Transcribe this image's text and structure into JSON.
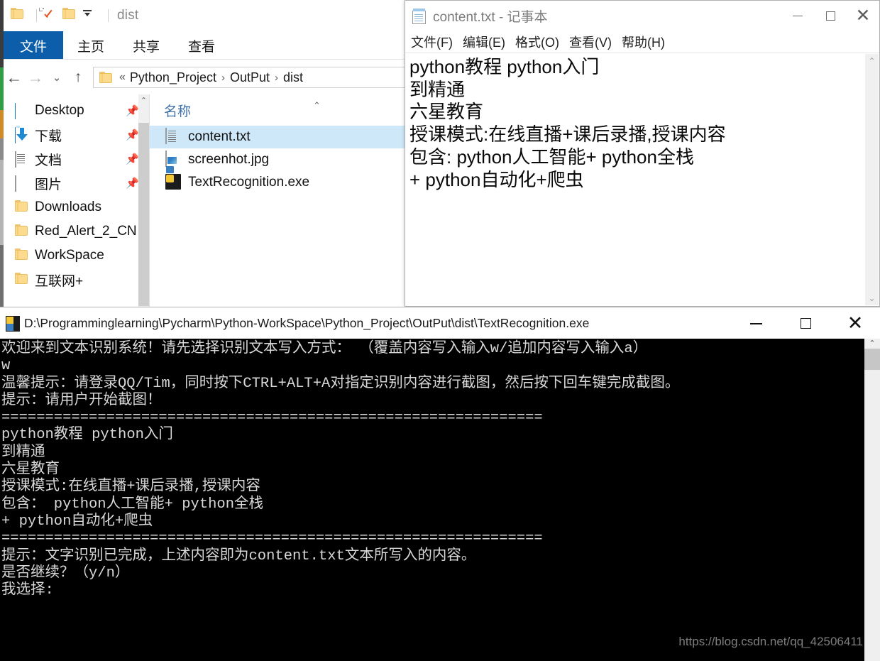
{
  "background_sliver": {
    "colors": [
      "#3c3c3c",
      "#2f9e44",
      "#d08a28",
      "#8a8a8a",
      "#b5b5b5",
      "#6f6f6f"
    ]
  },
  "explorer": {
    "quick_access": {
      "title": "dist",
      "icons": [
        "folder-icon",
        "properties-icon",
        "new-folder-icon",
        "customize-chevron-icon"
      ]
    },
    "ribbon_tabs": [
      {
        "label": "文件",
        "active": true
      },
      {
        "label": "主页",
        "active": false
      },
      {
        "label": "共享",
        "active": false
      },
      {
        "label": "查看",
        "active": false
      }
    ],
    "address": {
      "back": "←",
      "forward": "→",
      "recent": "⌄",
      "up": "↑",
      "overflow": "«",
      "crumbs": [
        "Python_Project",
        "OutPut",
        "dist"
      ],
      "separator": "›"
    },
    "nav_pane": [
      {
        "label": "Desktop",
        "icon": "desktop-icon",
        "pinned": true
      },
      {
        "label": "下载",
        "icon": "download-icon",
        "pinned": true
      },
      {
        "label": "文档",
        "icon": "documents-icon",
        "pinned": true
      },
      {
        "label": "图片",
        "icon": "pictures-icon",
        "pinned": true
      },
      {
        "label": "Downloads",
        "icon": "folder-icon",
        "pinned": false
      },
      {
        "label": "Red_Alert_2_CN",
        "icon": "folder-icon",
        "pinned": false
      },
      {
        "label": "WorkSpace",
        "icon": "folder-icon",
        "pinned": false
      },
      {
        "label": "互联网+",
        "icon": "folder-icon",
        "pinned": false
      }
    ],
    "list": {
      "column_header": "名称",
      "files": [
        {
          "name": "content.txt",
          "icon": "text-file-icon",
          "selected": true
        },
        {
          "name": "screenhot.jpg",
          "icon": "image-file-icon",
          "selected": false
        },
        {
          "name": "TextRecognition.exe",
          "icon": "python-exe-icon",
          "selected": false
        }
      ]
    }
  },
  "notepad": {
    "title": "content.txt - 记事本",
    "menu": [
      "文件(F)",
      "编辑(E)",
      "格式(O)",
      "查看(V)",
      "帮助(H)"
    ],
    "window_buttons": {
      "minimize": "minimize-icon",
      "maximize": "maximize-icon",
      "close": "close-icon"
    },
    "content_lines": [
      "python教程 python入门",
      "到精通",
      "六星教育",
      "授课模式:在线直播+课后录播,授课内容",
      "包含: python人工智能+ python全栈",
      "+ python自动化+爬虫"
    ],
    "scrollbar": {
      "up": "⌃",
      "down": "⌄"
    }
  },
  "console": {
    "title": "D:\\Programminglearning\\Pycharm\\Python-WorkSpace\\Python_Project\\OutPut\\dist\\TextRecognition.exe",
    "window_buttons": {
      "minimize": "minimize-icon",
      "maximize": "maximize-icon",
      "close": "close-icon"
    },
    "output_lines": [
      "欢迎来到文本识别系统！请先选择识别文本写入方式： （覆盖内容写入输入w/追加内容写入输入a）",
      "w",
      "温馨提示：请登录QQ/Tim，同时按下CTRL+ALT+A对指定识别内容进行截图，然后按下回车键完成截图。",
      "提示：请用户开始截图！",
      "==============================================================",
      "python教程 python入门",
      "到精通",
      "六星教育",
      "授课模式:在线直播+课后录播,授课内容",
      "包含： python人工智能+ python全栈",
      "+ python自动化+爬虫",
      "==============================================================",
      "提示：文字识别已完成，上述内容即为content.txt文本所写入的内容。",
      "是否继续？（y/n）",
      "我选择:"
    ],
    "watermark": "https://blog.csdn.net/qq_42506411"
  }
}
